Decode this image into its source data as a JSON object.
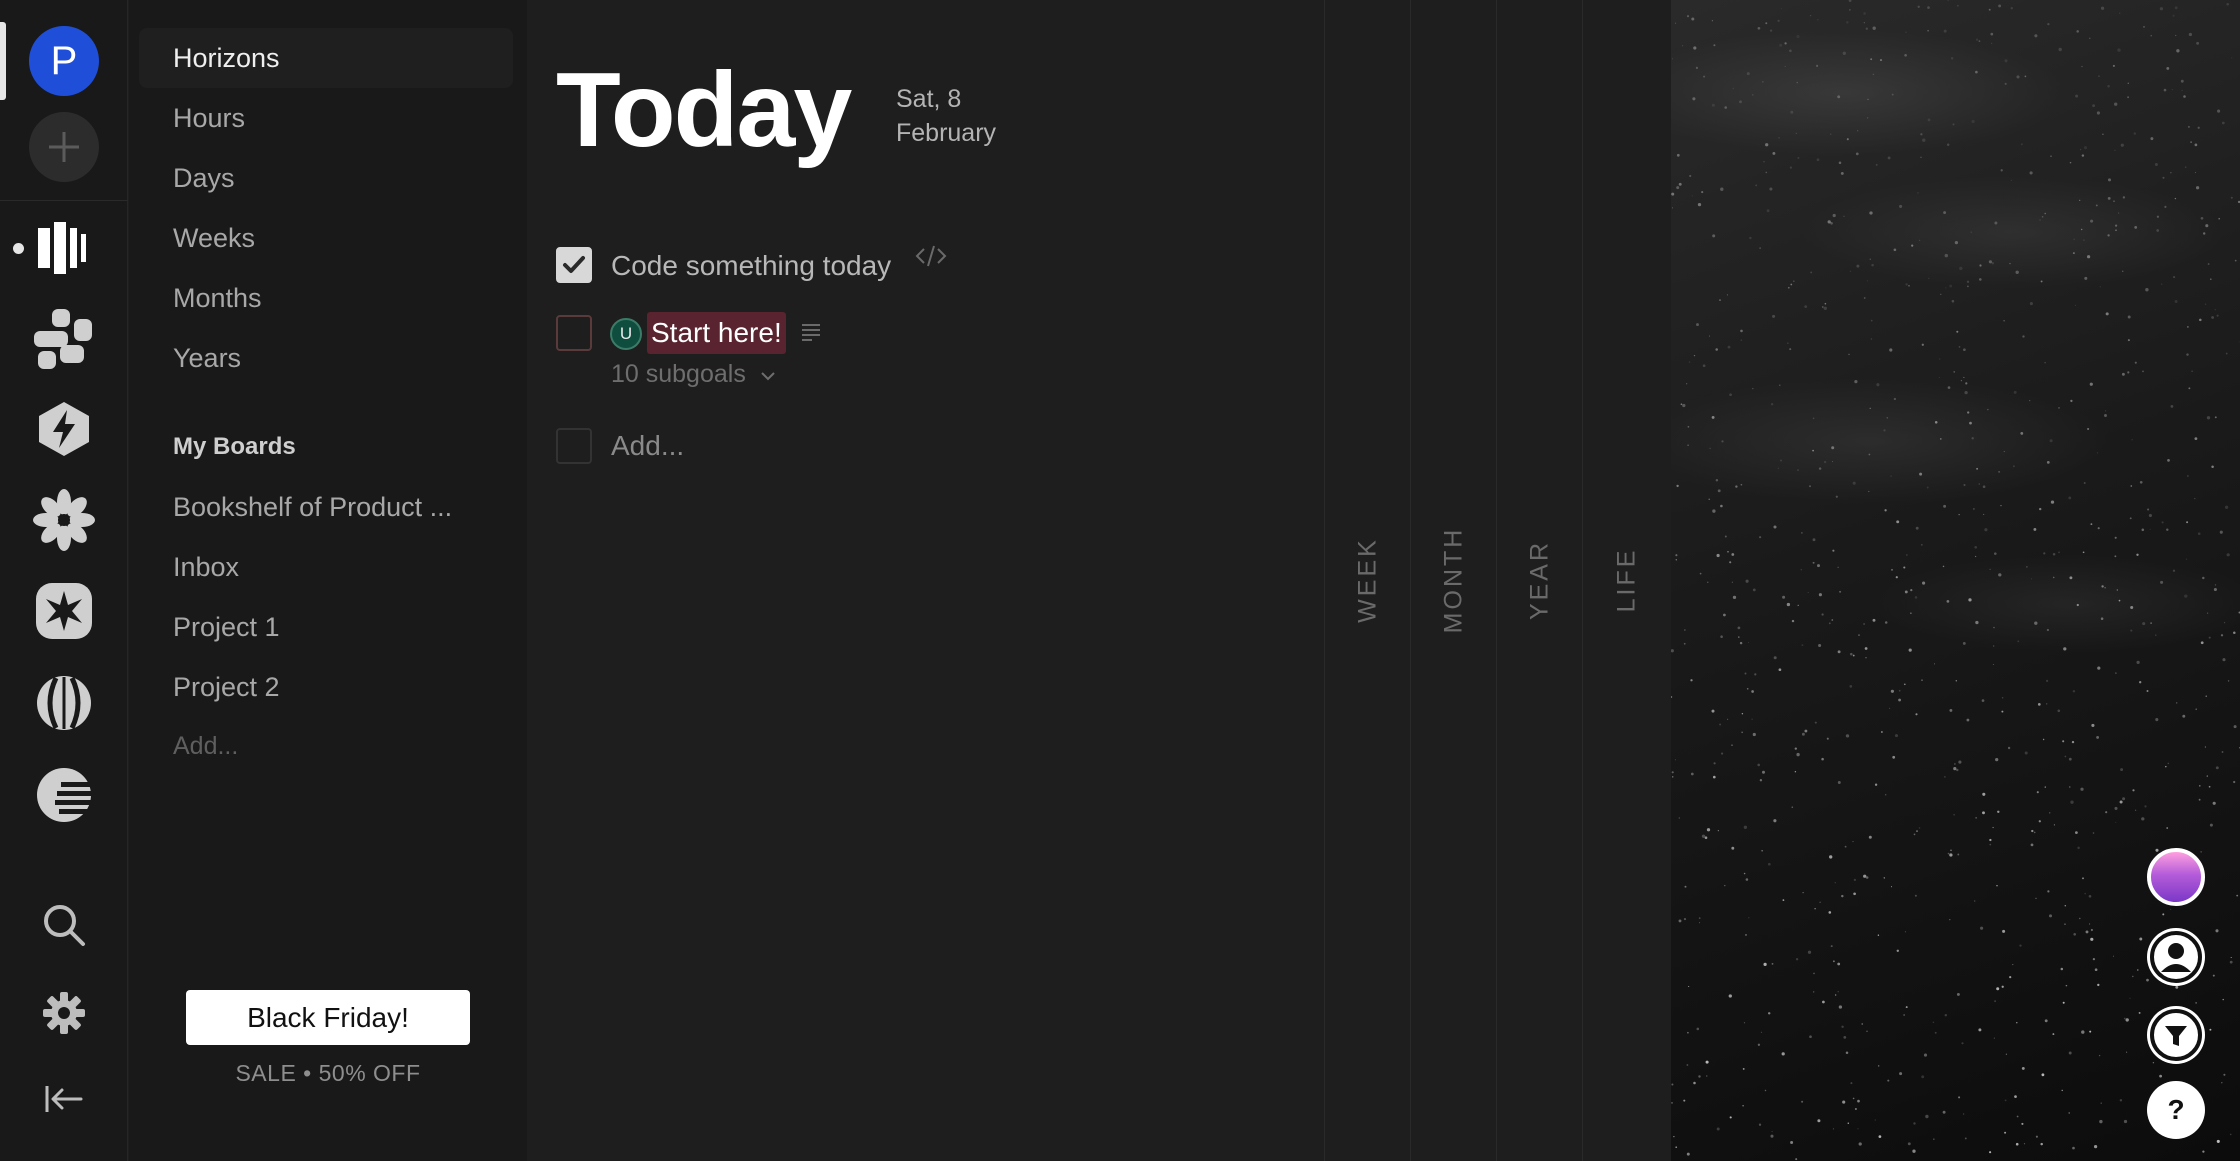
{
  "rail": {
    "workspace_initial": "P",
    "icons": [
      "add-icon",
      "bars-app-icon",
      "blocks-app-icon",
      "bolt-app-icon",
      "asterisk-app-icon",
      "starburst-app-icon",
      "globe-app-icon",
      "sunset-app-icon",
      "search-icon",
      "gear-icon",
      "collapse-icon"
    ]
  },
  "nav": {
    "items": [
      {
        "label": "Horizons"
      },
      {
        "label": "Hours"
      },
      {
        "label": "Days"
      },
      {
        "label": "Weeks"
      },
      {
        "label": "Months"
      },
      {
        "label": "Years"
      }
    ],
    "boards_heading": "My Boards",
    "boards": [
      {
        "label": "Bookshelf of Product ..."
      },
      {
        "label": "Inbox"
      },
      {
        "label": "Project 1"
      },
      {
        "label": "Project 2"
      }
    ],
    "add_board": "Add...",
    "promo": {
      "button": "Black Friday!",
      "subtitle": "SALE • 50% OFF"
    }
  },
  "main": {
    "title": "Today",
    "date_line1": "Sat, 8",
    "date_line2": "February",
    "tasks": [
      {
        "text": "Code something today",
        "checked": true
      },
      {
        "text": "Start here!",
        "checked": false,
        "assignee_initial": "U",
        "subgoals": "10 subgoals"
      }
    ],
    "add_placeholder": "Add..."
  },
  "horizons": [
    "WEEK",
    "MONTH",
    "YEAR",
    "LIFE"
  ],
  "colors": {
    "workspace_avatar": "#1f4fd8",
    "highlight": "#5a2330",
    "assignee_chip": "#0f4e3e",
    "background": "#1e1e1e"
  }
}
